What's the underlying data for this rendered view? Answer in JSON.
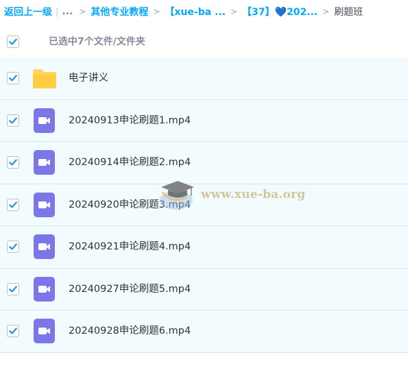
{
  "breadcrumb": {
    "back": "返回上一级",
    "ellipsis": "...",
    "items": [
      "其他专业教程",
      "【xue-ba ...",
      "【37】💙202..."
    ],
    "current": "刷题班"
  },
  "selection": {
    "label": "已选中7个文件/文件夹",
    "checked": true
  },
  "files": [
    {
      "name": "电子讲义",
      "type": "folder",
      "checked": true
    },
    {
      "name": "20240913申论刷题1.mp4",
      "type": "video",
      "checked": true
    },
    {
      "name": "20240914申论刷题2.mp4",
      "type": "video",
      "checked": true
    },
    {
      "name": "20240920申论刷题3.mp4",
      "type": "video",
      "checked": true
    },
    {
      "name": "20240921申论刷题4.mp4",
      "type": "video",
      "checked": true
    },
    {
      "name": "20240927申论刷题5.mp4",
      "type": "video",
      "checked": true
    },
    {
      "name": "20240928申论刷题6.mp4",
      "type": "video",
      "checked": true
    }
  ],
  "watermark": {
    "text": "www.xue-ba.org",
    "icon": "graduation-cap-icon"
  },
  "colors": {
    "accent": "#06a7ff",
    "check": "#2196d8",
    "video_icon": "#7b77e8",
    "folder_icon": "#ffd55c",
    "row_bg": "#f2fbfe"
  }
}
